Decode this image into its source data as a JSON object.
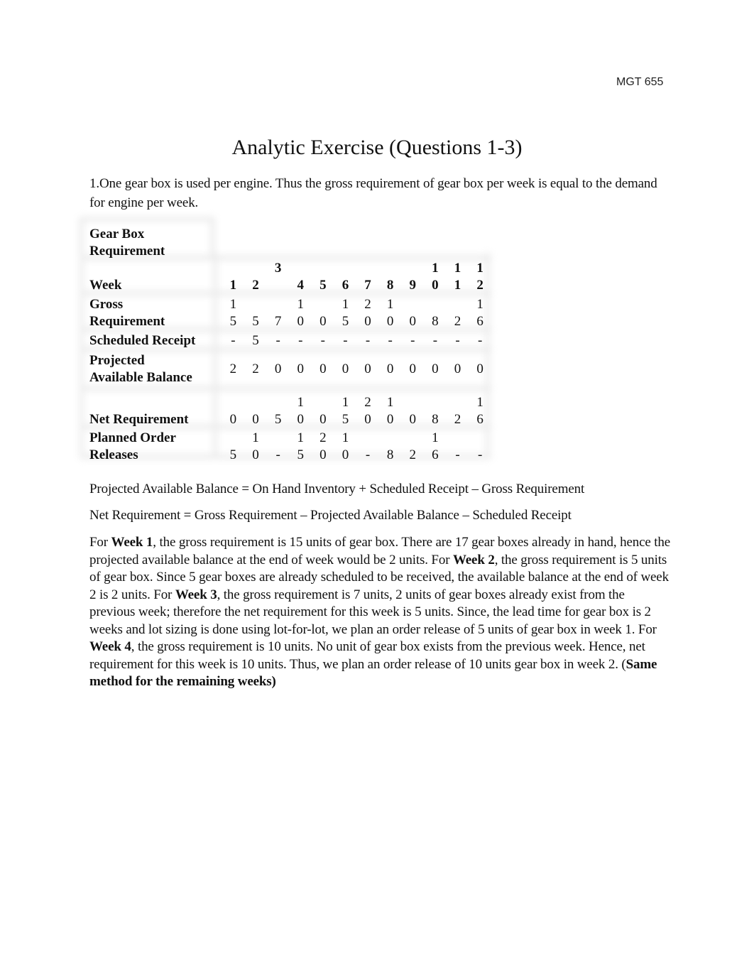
{
  "header": {
    "course_code": "MGT 655"
  },
  "title": "Analytic Exercise (Questions 1-3)",
  "intro": "1.One gear box is used per engine. Thus the gross requirement of gear box per week is equal to the demand for engine per week.",
  "table": {
    "title_line1": "Gear Box",
    "title_line2": "Requirement",
    "rows": {
      "week": {
        "label": "Week",
        "values": [
          "1",
          "2",
          "3",
          "4",
          "5",
          "6",
          "7",
          "8",
          "9",
          "10",
          "11",
          "12"
        ]
      },
      "gross": {
        "label_line1": "Gross",
        "label_line2": "Requirement",
        "values": [
          "15",
          "5",
          "7",
          "10",
          "0",
          "15",
          "20",
          "10",
          "0",
          "8",
          "2",
          "16"
        ]
      },
      "scheduled": {
        "label": "Scheduled Receipt",
        "values": [
          "-",
          "5",
          "-",
          "-",
          "-",
          "-",
          "-",
          "-",
          "-",
          "-",
          "-",
          "-"
        ]
      },
      "pab": {
        "label_line1": "Projected",
        "label_line2": "Available Balance",
        "values": [
          "2",
          "2",
          "0",
          "0",
          "0",
          "0",
          "0",
          "0",
          "0",
          "0",
          "0",
          "0"
        ]
      },
      "net": {
        "label": "Net Requirement",
        "values": [
          "0",
          "0",
          "5",
          "10",
          "0",
          "15",
          "20",
          "10",
          "0",
          "8",
          "2",
          "16"
        ]
      },
      "por": {
        "label_line1": "Planned Order",
        "label_line2": "Releases",
        "values": [
          "5",
          "10",
          "-",
          "15",
          "20",
          "10",
          "-",
          "8",
          "2",
          "16",
          "-",
          "-"
        ]
      }
    }
  },
  "formula1": "Projected Available Balance = On Hand Inventory + Scheduled Receipt – Gross Requirement",
  "formula2": "Net Requirement = Gross Requirement – Projected Available Balance – Scheduled Receipt",
  "explanation": [
    {
      "t": "For ",
      "b": false
    },
    {
      "t": "Week 1",
      "b": true
    },
    {
      "t": ", the gross requirement is 15 units of gear box. There are 17 gear boxes already in hand, hence the projected available balance at the end of week would be 2 units. For ",
      "b": false
    },
    {
      "t": "Week 2",
      "b": true
    },
    {
      "t": ", the gross requirement is 5 units of gear box. Since 5 gear boxes are already scheduled to be received, the available balance at the end of week 2 is 2 units. For ",
      "b": false
    },
    {
      "t": "Week 3",
      "b": true
    },
    {
      "t": ", the gross requirement is 7 units, 2 units of gear boxes already exist from the previous week; therefore the net requirement for this week is 5 units. Since, the lead time for gear box is 2 weeks and lot sizing is done using lot-for-lot, we plan an order release of 5 units of gear box in week 1. For ",
      "b": false
    },
    {
      "t": "Week 4",
      "b": true
    },
    {
      "t": ", the gross requirement is 10 units. No unit of gear box exists from the previous week. Hence, net requirement for this week is 10 units. Thus, we plan an order release of 10 units gear box in week 2. (",
      "b": false
    },
    {
      "t": "Same method for the remaining weeks)",
      "b": true
    }
  ]
}
